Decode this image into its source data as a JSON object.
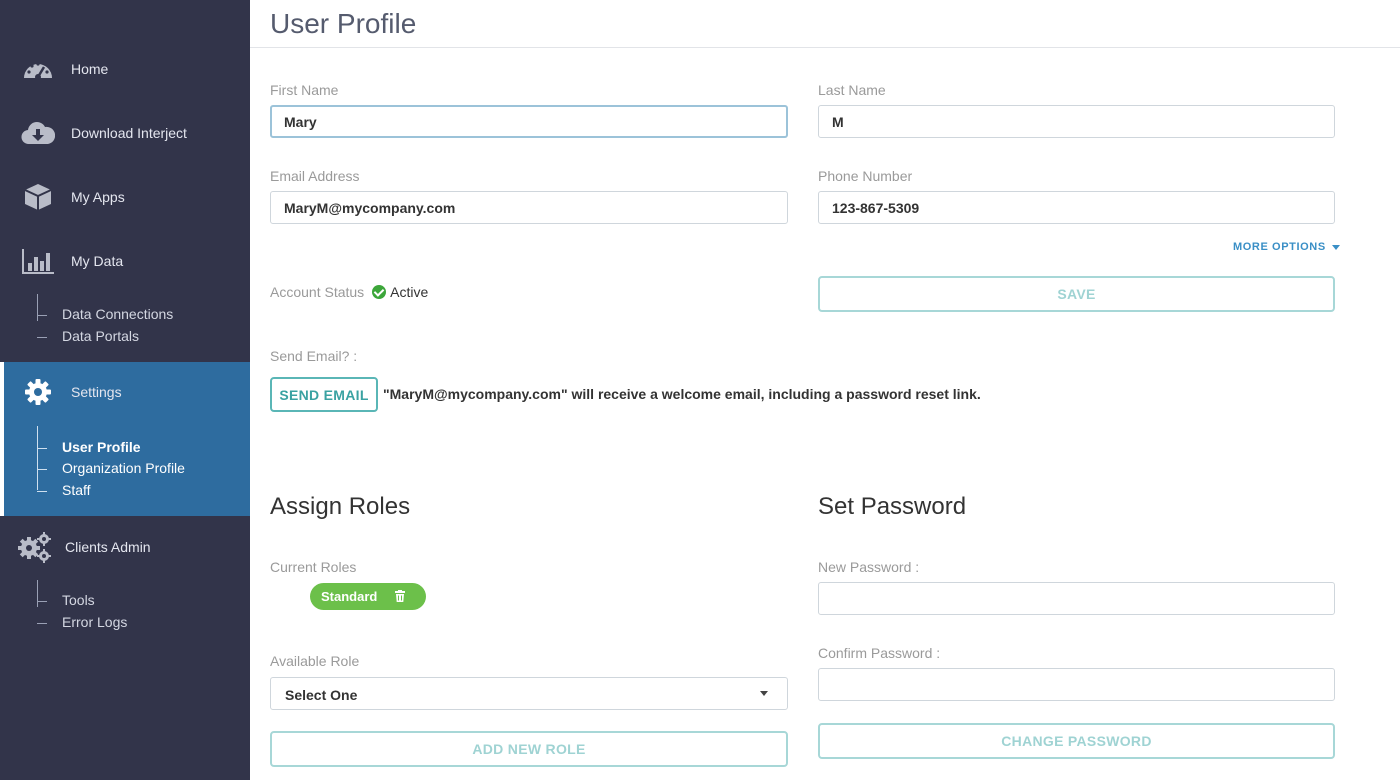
{
  "sidebar": {
    "items": [
      {
        "label": "Home",
        "icon": "dashboard-gauge-icon"
      },
      {
        "label": "Download Interject",
        "icon": "cloud-download-icon"
      },
      {
        "label": "My Apps",
        "icon": "cube-icon"
      },
      {
        "label": "My Data",
        "icon": "bar-chart-icon"
      },
      {
        "label": "Settings",
        "icon": "gear-icon"
      },
      {
        "label": "Clients Admin",
        "icon": "gears-icon"
      }
    ],
    "my_data_sub": [
      "Data Connections",
      "Data Portals"
    ],
    "settings_sub": [
      "User Profile",
      "Organization Profile",
      "Staff"
    ],
    "clients_admin_sub": [
      "Tools",
      "Error Logs"
    ],
    "active_sub": "User Profile"
  },
  "page": {
    "title": "User Profile"
  },
  "form": {
    "first_name": {
      "label": "First Name",
      "value": "Mary"
    },
    "last_name": {
      "label": "Last Name",
      "value": "M"
    },
    "email": {
      "label": "Email Address",
      "value": "MaryM@mycompany.com"
    },
    "phone": {
      "label": "Phone Number",
      "value": "123-867-5309"
    },
    "more_options": "MORE OPTIONS",
    "account_status": {
      "label": "Account Status",
      "value": "Active"
    },
    "save_label": "SAVE",
    "send_email": {
      "label": "Send Email? :",
      "button": "SEND EMAIL",
      "note": "\"MaryM@mycompany.com\" will receive a welcome email, including a password reset link."
    }
  },
  "roles": {
    "title": "Assign Roles",
    "current_label": "Current Roles",
    "current": [
      "Standard"
    ],
    "available_label": "Available Role",
    "select_value": "Select One",
    "add_button": "ADD NEW ROLE"
  },
  "password": {
    "title": "Set Password",
    "new_label": "New Password :",
    "confirm_label": "Confirm Password :",
    "change_button": "CHANGE PASSWORD"
  },
  "colors": {
    "sidebar_bg": "#32344a",
    "active_bg": "#2e6c9f",
    "accent_teal": "#5ab6b6",
    "link_blue": "#3a8fc6",
    "role_green": "#6cc04a",
    "status_green": "#3ca63a"
  }
}
